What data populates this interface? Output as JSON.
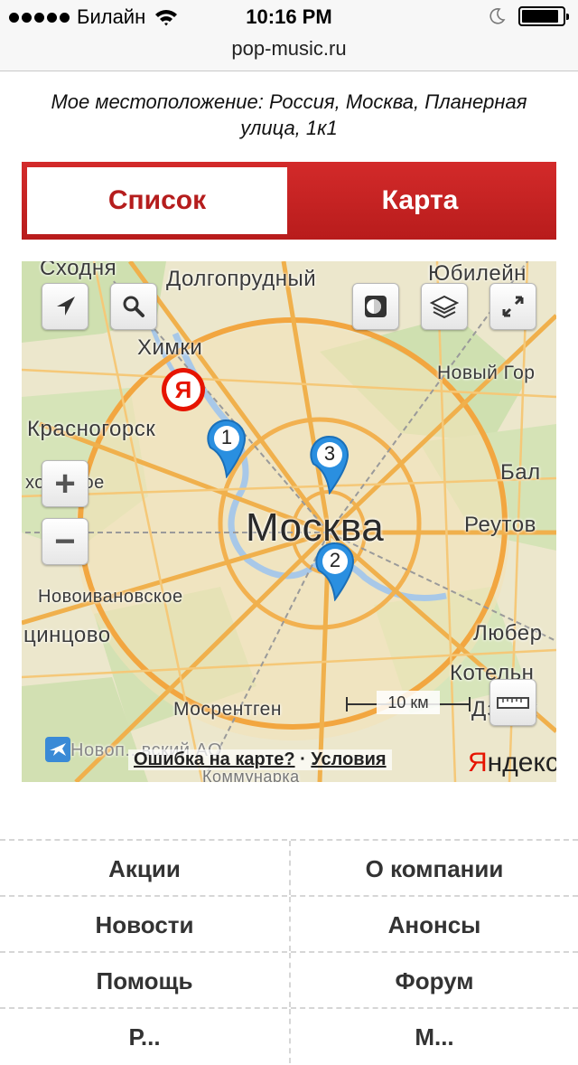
{
  "status_bar": {
    "carrier": "Билайн",
    "time": "10:16 PM"
  },
  "browser": {
    "url": "pop-music.ru"
  },
  "location_text": "Мое местоположение: Россия, Москва, Планерная улица, 1к1",
  "tabs": {
    "list_label": "Список",
    "map_label": "Карта"
  },
  "map": {
    "labels": {
      "skhodnya": "Сходня",
      "dolgoprudny": "Долгопрудный",
      "yubileyny": "Юбилейн",
      "khimki": "Химки",
      "novy_gorod": "Новый Гор",
      "krasnogorsk": "Красногорск",
      "nikolskoe": "хольское",
      "bal": "Бал",
      "moskva": "Москва",
      "reutov": "Реутов",
      "novoivanovskoe": "Новоивановское",
      "odintsovo": "цинцово",
      "lyuber": "Любер",
      "kotelniki": "Котельн",
      "dzerzh": "Дзерж",
      "mosrentgen": "Мосрентген",
      "vnukovo": "Новоп...вский АО",
      "kommunarka": "Коммунарка"
    },
    "pins": [
      "1",
      "2",
      "3"
    ],
    "yandex_marker": "Я",
    "scale": "10 км",
    "error_link": "Ошибка на карте?",
    "separator": "·",
    "terms_link": "Условия",
    "logo": "Яндекс",
    "buttons": {
      "locate": "navigation-arrow-icon",
      "search": "search-icon",
      "traffic": "traffic-icon",
      "layers": "layers-icon",
      "fullscreen": "fullscreen-icon",
      "zoom_in": "+",
      "zoom_out": "−",
      "ruler": "ruler-icon"
    }
  },
  "menu": [
    [
      "Акции",
      "О компании"
    ],
    [
      "Новости",
      "Анонсы"
    ],
    [
      "Помощь",
      "Форум"
    ],
    [
      "Р...",
      "М..."
    ]
  ],
  "colors": {
    "accent_red": "#c4201f",
    "pin_blue": "#2a8fe0"
  }
}
